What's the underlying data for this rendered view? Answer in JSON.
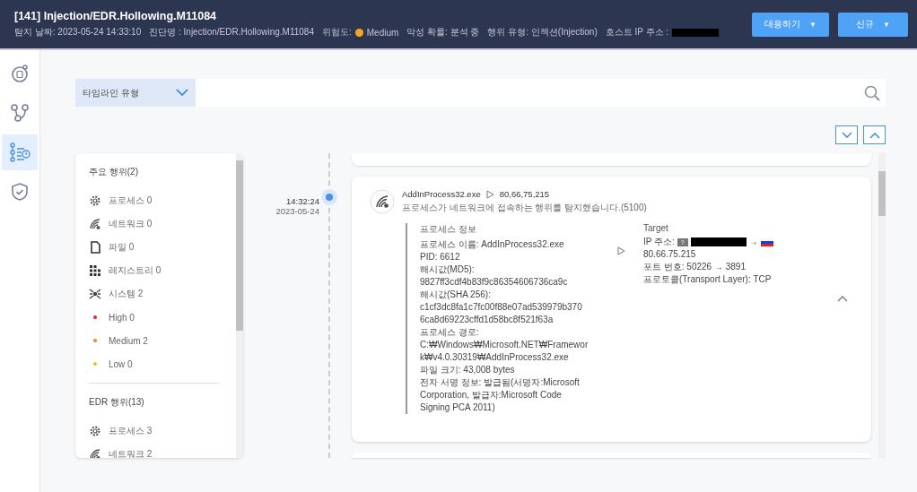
{
  "header": {
    "title": "[141] Injection/EDR.Hollowing.M11084",
    "meta": [
      {
        "kind": "text",
        "text": "탐지 날짜: 2023-05-24 14:33:10"
      },
      {
        "kind": "text",
        "text": "진단명 : Injection/EDR.Hollowing.M11084"
      },
      {
        "kind": "risk",
        "label": "위험도:",
        "value": "Medium",
        "color": "#f5a623"
      },
      {
        "kind": "text",
        "text": "악성 확률: 분석 중"
      },
      {
        "kind": "text",
        "text": "행위 유형: 인젝션(Injection)"
      },
      {
        "kind": "redacted",
        "text": "호스트 IP 주소 :"
      }
    ],
    "buttons": [
      {
        "label": "대응하기",
        "caret": "▼"
      },
      {
        "label": "신규",
        "caret": "▼"
      }
    ]
  },
  "nav": [
    {
      "selected": false
    },
    {
      "selected": false
    },
    {
      "selected": true
    },
    {
      "selected": false
    }
  ],
  "filter": {
    "label": "타임라인 유형"
  },
  "summary": [
    {
      "title": "주요 행위(2)",
      "items": [
        {
          "kind": "category",
          "label": "프로세스 0"
        },
        {
          "kind": "category",
          "label": "네트워크 0"
        },
        {
          "kind": "category",
          "label": "파일 0"
        },
        {
          "kind": "category",
          "label": "레지스트리 0"
        },
        {
          "kind": "category",
          "label": "시스템 2"
        },
        {
          "kind": "severity",
          "label": "High 0",
          "color": "#e8202a"
        },
        {
          "kind": "severity",
          "label": "Medium 2",
          "color": "#f08a1c"
        },
        {
          "kind": "severity",
          "label": "Low 0",
          "color": "#f5b82e"
        }
      ]
    },
    {
      "title": "EDR 행위(13)",
      "items": [
        {
          "kind": "category",
          "label": "프로세스 3"
        },
        {
          "kind": "category",
          "label": "네트워크 2"
        }
      ]
    }
  ],
  "event": {
    "time": "14:32:24",
    "date": "2023-05-24",
    "process": "AddInProcess32.exe",
    "target": "80,66,75,215",
    "description": "프로세스가 네트워크에 접속하는 행위를 탐지했습니다.(5100)",
    "process_info": {
      "heading": "프로세스 정보",
      "lines": [
        "프로세스 이름: AddInProcess32.exe",
        "PID: 6612",
        "해시값(MD5):",
        "9827ff3cdf4b83f9c86354606736ca9c",
        "해시값(SHA 256):",
        "c1cf3dc8fa1c7fc00f88e07ad539979b370",
        "6ca8d69223cffd1d58bc8f521f63a",
        "프로세스 경로:",
        "C:₩Windows₩Microsoft.NET₩Framewor",
        "k₩v4.0.30319₩AddInProcess32.exe",
        "파일 크기: 43,008 bytes",
        "전자 서명 정보: 발급됨(서명자:Microsoft",
        "Corporation, 발급자:Microsoft Code",
        "Signing PCA 2011)"
      ]
    },
    "target_info": {
      "heading": "Target",
      "ip_label": "IP 주소:",
      "ip_badge": "?",
      "ip_arrow": "→",
      "ip": "80.66.75.215",
      "lines": [
        "포트 번호: 50226 → 3891",
        "프로토콜(Transport Layer): TCP"
      ]
    },
    "expanded": true
  }
}
